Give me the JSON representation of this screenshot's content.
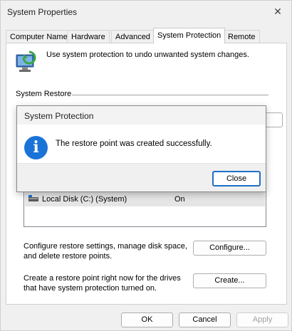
{
  "window": {
    "title": "System Properties",
    "close_glyph": "✕"
  },
  "tabs": [
    {
      "label": "Computer Name",
      "active": false
    },
    {
      "label": "Hardware",
      "active": false
    },
    {
      "label": "Advanced",
      "active": false
    },
    {
      "label": "System Protection",
      "active": true
    },
    {
      "label": "Remote",
      "active": false
    }
  ],
  "protection": {
    "intro_text": "Use system protection to undo unwanted system changes.",
    "system_restore_label": "System Restore",
    "drives": [
      {
        "name": "Local Disk (C:) (System)",
        "protection": "On"
      }
    ],
    "configure_text": "Configure restore settings, manage disk space, and delete restore points.",
    "configure_button": "Configure...",
    "create_text": "Create a restore point right now for the drives that have system protection turned on.",
    "create_button": "Create..."
  },
  "footer": {
    "ok": "OK",
    "cancel": "Cancel",
    "apply": "Apply"
  },
  "dialog": {
    "title": "System Protection",
    "icon": "info-icon",
    "icon_glyph": "i",
    "message": "The restore point was created successfully.",
    "close_button": "Close",
    "accent_color": "#1a73d6"
  }
}
